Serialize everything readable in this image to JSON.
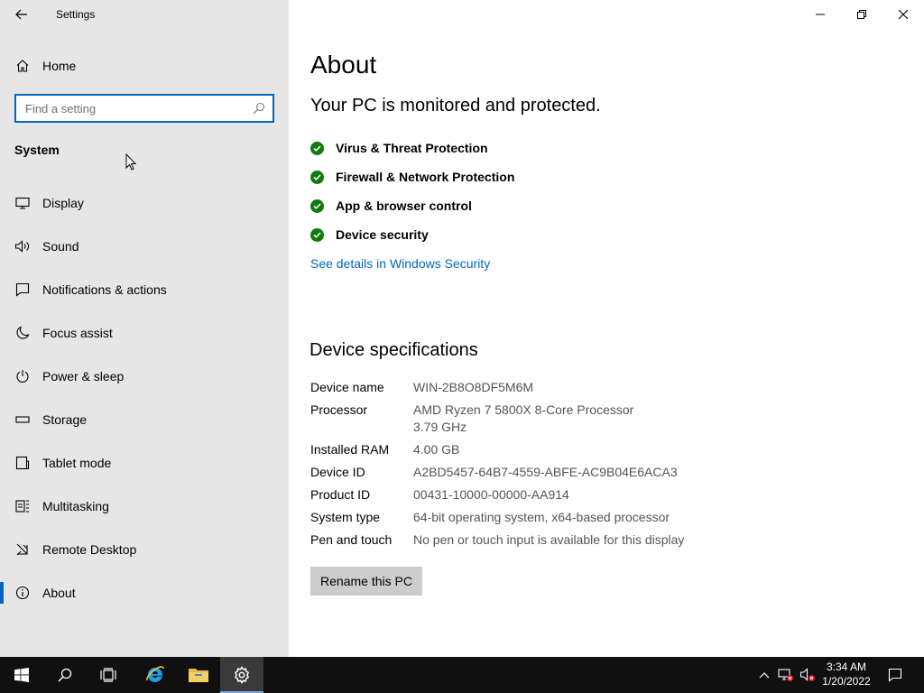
{
  "window": {
    "title": "Settings"
  },
  "sidebar": {
    "home_label": "Home",
    "search_placeholder": "Find a setting",
    "section_title": "System",
    "items": [
      {
        "label": "Display",
        "icon": "display-icon"
      },
      {
        "label": "Sound",
        "icon": "speaker-icon"
      },
      {
        "label": "Notifications & actions",
        "icon": "notification-icon"
      },
      {
        "label": "Focus assist",
        "icon": "moon-icon"
      },
      {
        "label": "Power & sleep",
        "icon": "power-icon"
      },
      {
        "label": "Storage",
        "icon": "storage-icon"
      },
      {
        "label": "Tablet mode",
        "icon": "tablet-icon"
      },
      {
        "label": "Multitasking",
        "icon": "multitasking-icon"
      },
      {
        "label": "Remote Desktop",
        "icon": "remote-desktop-icon"
      },
      {
        "label": "About",
        "icon": "info-icon",
        "selected": true
      }
    ]
  },
  "main": {
    "title": "About",
    "protection_heading": "Your PC is monitored and protected.",
    "protection_items": [
      "Virus & Threat Protection",
      "Firewall & Network Protection",
      "App & browser control",
      "Device security"
    ],
    "security_link": "See details in Windows Security",
    "specs_heading": "Device specifications",
    "specs": [
      {
        "label": "Device name",
        "value": "WIN-2B8O8DF5M6M"
      },
      {
        "label": "Processor",
        "value": "AMD Ryzen 7 5800X 8-Core Processor                  3.79 GHz"
      },
      {
        "label": "Installed RAM",
        "value": "4.00 GB"
      },
      {
        "label": "Device ID",
        "value": "A2BD5457-64B7-4559-ABFE-AC9B04E6ACA3"
      },
      {
        "label": "Product ID",
        "value": "00431-10000-00000-AA914"
      },
      {
        "label": "System type",
        "value": "64-bit operating system, x64-based processor"
      },
      {
        "label": "Pen and touch",
        "value": "No pen or touch input is available for this display"
      }
    ],
    "rename_button": "Rename this PC"
  },
  "taskbar": {
    "time": "3:34 AM",
    "date": "1/20/2022"
  },
  "colors": {
    "accent": "#0067c0",
    "sidebar_bg": "#e6e6e6",
    "check_green": "#107c10",
    "taskbar_bg": "#101010"
  }
}
